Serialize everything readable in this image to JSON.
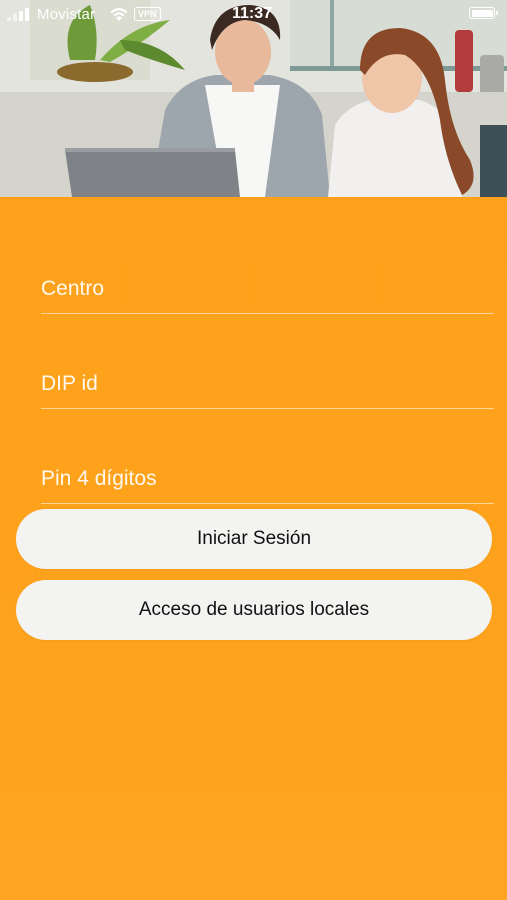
{
  "status_bar": {
    "carrier": "Movistar",
    "vpn": "VPN",
    "time": "11:37"
  },
  "hero": {
    "description_icon": "photo-mother-daughter-laptop"
  },
  "form": {
    "fields": [
      {
        "placeholder": "Centro",
        "value": ""
      },
      {
        "placeholder": "DIP id",
        "value": ""
      },
      {
        "placeholder": "Pin 4 dígitos",
        "value": ""
      }
    ],
    "login_button": "Iniciar Sesión",
    "local_users_button": "Acceso de usuarios locales"
  },
  "colors": {
    "primary_orange": "#fda21a",
    "button_background": "#f3f3f1",
    "button_text": "#111111"
  }
}
